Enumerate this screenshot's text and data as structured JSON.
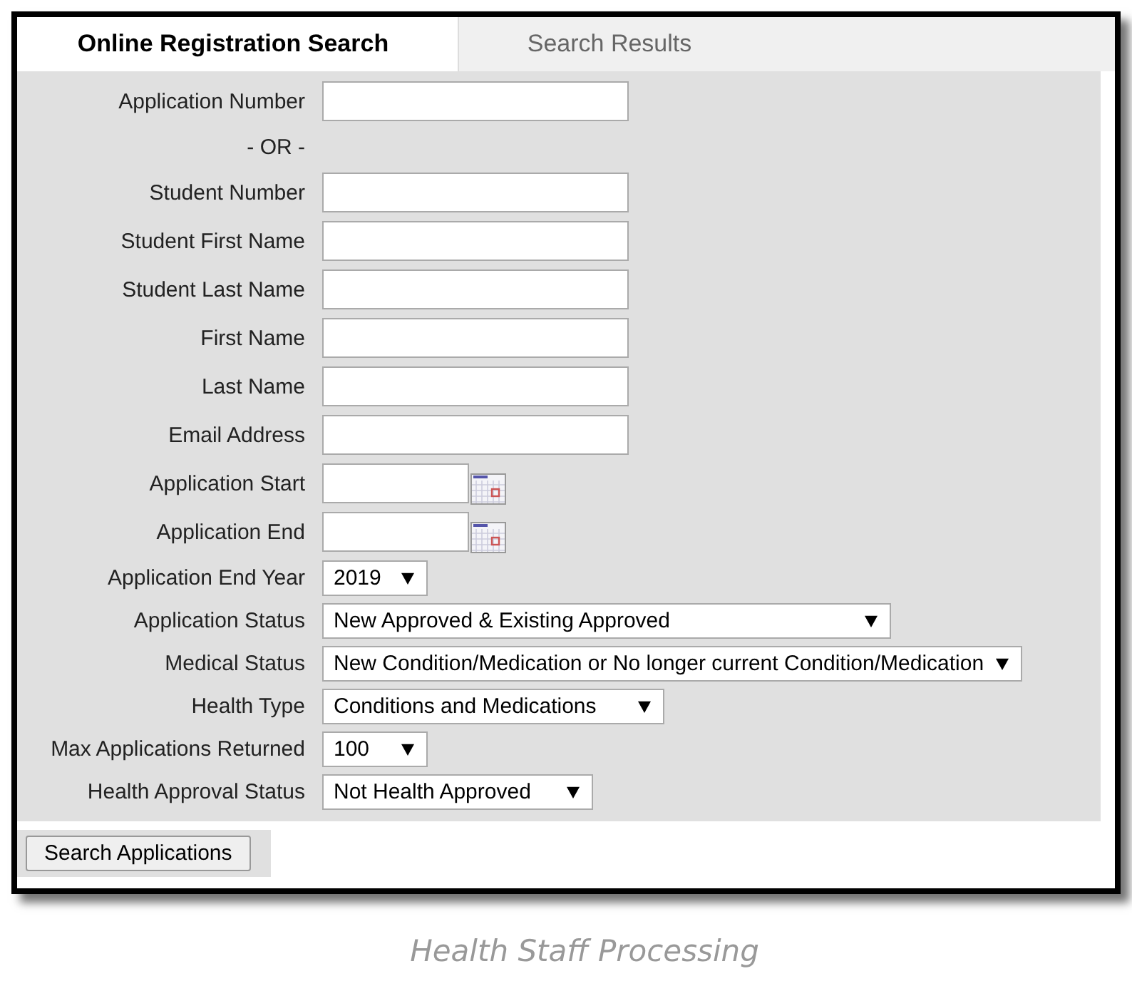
{
  "tabs": [
    {
      "label": "Online Registration Search",
      "selected": true
    },
    {
      "label": "Search Results",
      "selected": false
    }
  ],
  "fields": [
    {
      "kind": "text",
      "label": "Application Number"
    },
    {
      "kind": "separator",
      "label": "- OR -"
    },
    {
      "kind": "text",
      "label": "Student Number"
    },
    {
      "kind": "text",
      "label": "Student First Name"
    },
    {
      "kind": "text",
      "label": "Student Last Name"
    },
    {
      "kind": "text",
      "label": "First Name"
    },
    {
      "kind": "text",
      "label": "Last Name"
    },
    {
      "kind": "text",
      "label": "Email Address"
    },
    {
      "kind": "date",
      "label": "Application Start"
    },
    {
      "kind": "date",
      "label": "Application End"
    },
    {
      "kind": "select",
      "label": "Application End Year",
      "value": "2019"
    },
    {
      "kind": "select",
      "label": "Application Status",
      "value": "New Approved & Existing Approved"
    },
    {
      "kind": "select",
      "label": "Medical Status",
      "value": "New Condition/Medication or No longer current Condition/Medication"
    },
    {
      "kind": "select",
      "label": "Health Type",
      "value": "Conditions and Medications"
    },
    {
      "kind": "select",
      "label": "Max Applications Returned",
      "value": "100"
    },
    {
      "kind": "select",
      "label": "Health Approval Status",
      "value": "Not Health Approved"
    }
  ],
  "button": "Search Applications",
  "caption": "Health Staff Processing"
}
